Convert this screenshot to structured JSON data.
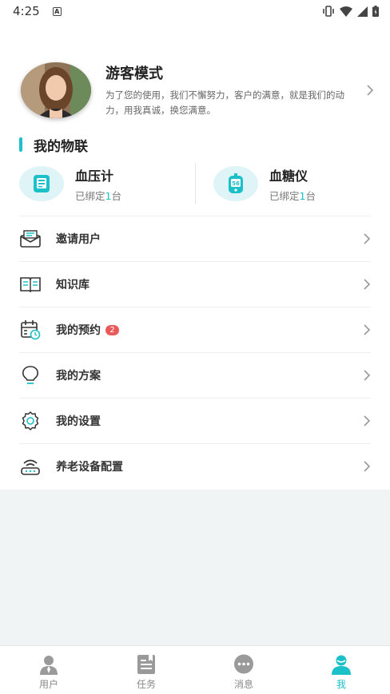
{
  "status_bar": {
    "time": "4:25",
    "notification_icon": "A"
  },
  "profile": {
    "name": "游客模式",
    "description": "为了您的使用，我们不懈努力，客户的满意，就是我们的动力，用我真诚，换您满意。",
    "avatar_icon": "avatar-photo"
  },
  "section": {
    "title": "我的物联"
  },
  "devices": [
    {
      "name": "血压计",
      "status_prefix": "已绑定",
      "count": "1",
      "status_suffix": "台",
      "icon": "blood-pressure-icon"
    },
    {
      "name": "血糖仪",
      "status_prefix": "已绑定",
      "count": "1",
      "status_suffix": "台",
      "icon": "glucose-meter-icon"
    }
  ],
  "menu": [
    {
      "label": "邀请用户",
      "icon": "invite-envelope-icon"
    },
    {
      "label": "知识库",
      "icon": "book-icon"
    },
    {
      "label": "我的预约",
      "icon": "calendar-clock-icon",
      "badge": "2"
    },
    {
      "label": "我的方案",
      "icon": "lightbulb-icon"
    },
    {
      "label": "我的设置",
      "icon": "gear-icon"
    },
    {
      "label": "养老设备配置",
      "icon": "router-icon"
    }
  ],
  "tabs": [
    {
      "label": "用户",
      "icon": "user-icon",
      "active": false
    },
    {
      "label": "任务",
      "icon": "task-icon",
      "active": false
    },
    {
      "label": "消息",
      "icon": "message-icon",
      "active": false
    },
    {
      "label": "我",
      "icon": "me-icon",
      "active": true
    }
  ],
  "colors": {
    "accent": "#1cc0c8",
    "badge": "#e85a5a",
    "background_gray": "#f1f4f5"
  }
}
